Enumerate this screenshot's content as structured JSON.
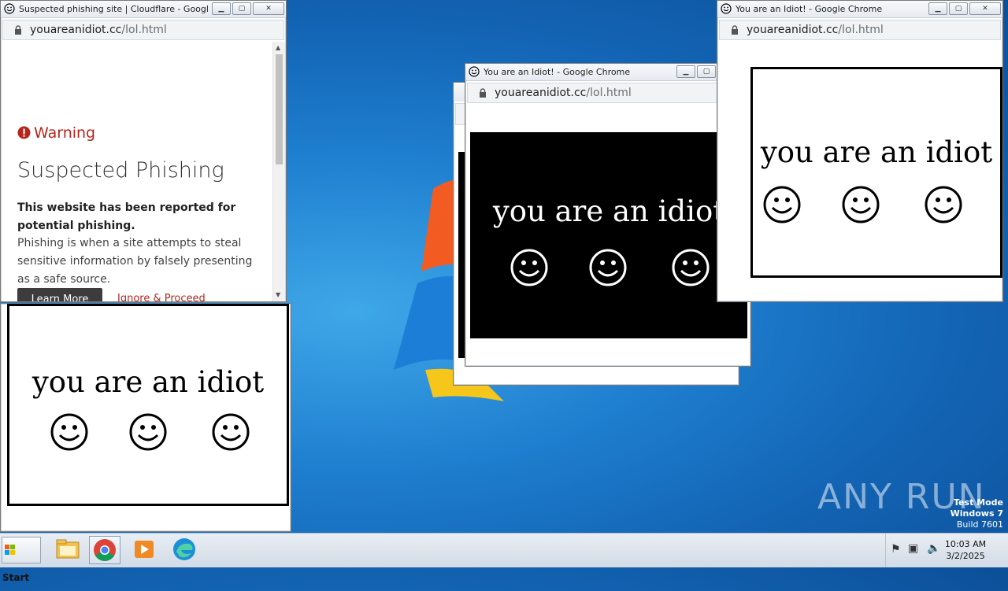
{
  "colors": {
    "accent_red": "#b3261e",
    "learn_more_bg": "#3c3c3c"
  },
  "windows": {
    "phish": {
      "title": "Suspected phishing site | Cloudflare - Google C...",
      "url_host": "youareanidiot.cc",
      "url_path": "/lol.html",
      "warning_label": "Warning",
      "heading": "Suspected Phishing",
      "bold_line": "This website has been reported for potential phishing.",
      "body": "Phishing is when a site attempts to steal sensitive information by falsely presenting as a safe source.",
      "learn_more": "Learn More",
      "ignore": "Ignore & Proceed"
    },
    "idiot_bottom_left": {
      "text": "you are an idiot"
    },
    "idiot_center": {
      "title": "You are an Idiot! - Google Chrome",
      "url_host": "youareanidiot.cc",
      "url_path": "/lol.html",
      "text": "you are an idiot"
    },
    "idiot_right": {
      "title": "You are an Idiot! - Google Chrome",
      "url_host": "youareanidiot.cc",
      "url_path": "/lol.html",
      "text": "you are an idiot"
    }
  },
  "taskbar": {
    "start_label": "Start",
    "apps": [
      "file-explorer-icon",
      "chrome-icon",
      "media-player-icon",
      "edge-icon"
    ],
    "time": "10:03 AM",
    "date": "3/2/2025"
  },
  "watermark": "ANY RUN",
  "test_mode": {
    "line1": "Test Mode",
    "line2": "Windows 7",
    "line3": "Build 7601"
  }
}
